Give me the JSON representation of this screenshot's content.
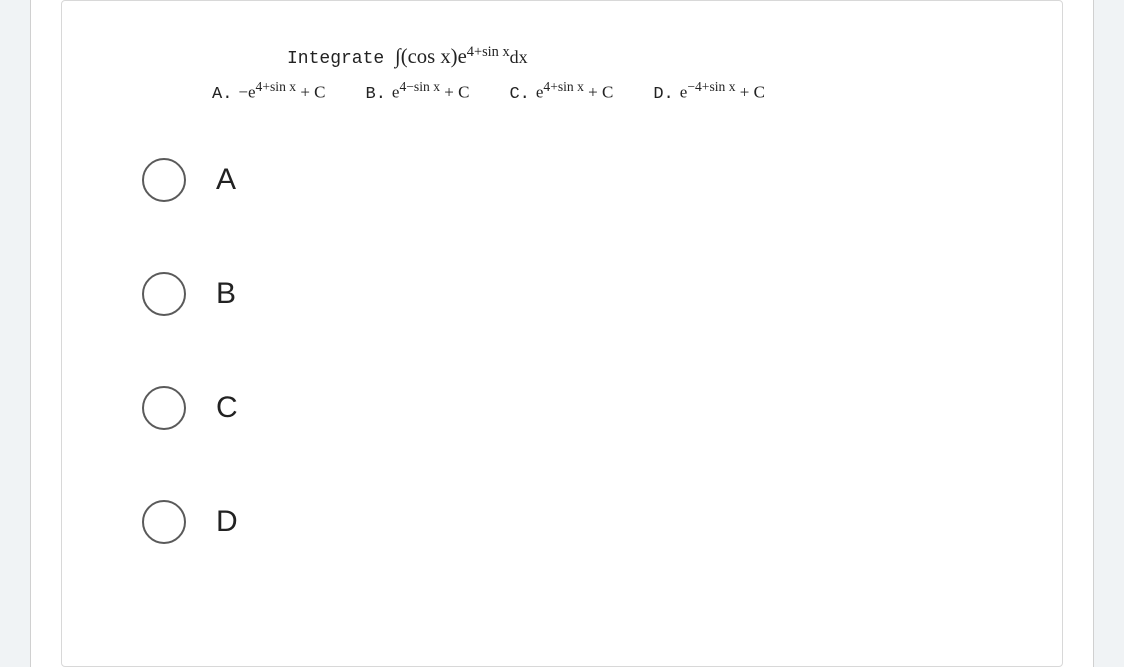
{
  "question": {
    "prompt_prefix": "Integrate ",
    "integrand_base": "∫(cos x)e",
    "integrand_exp": "4+sin x",
    "integrand_suffix": "dx",
    "answers": {
      "A": {
        "label": "A.",
        "pre": "−e",
        "exp": "4+sin x",
        "post": " + C"
      },
      "B": {
        "label": "B.",
        "pre": "e",
        "exp": "4−sin x",
        "post": " + C"
      },
      "C": {
        "label": "C.",
        "pre": "e",
        "exp": "4+sin x",
        "post": " + C"
      },
      "D": {
        "label": "D.",
        "pre": "e",
        "exp": "−4+sin x",
        "post": " + C"
      }
    }
  },
  "options": {
    "A": "A",
    "B": "B",
    "C": "C",
    "D": "D"
  }
}
